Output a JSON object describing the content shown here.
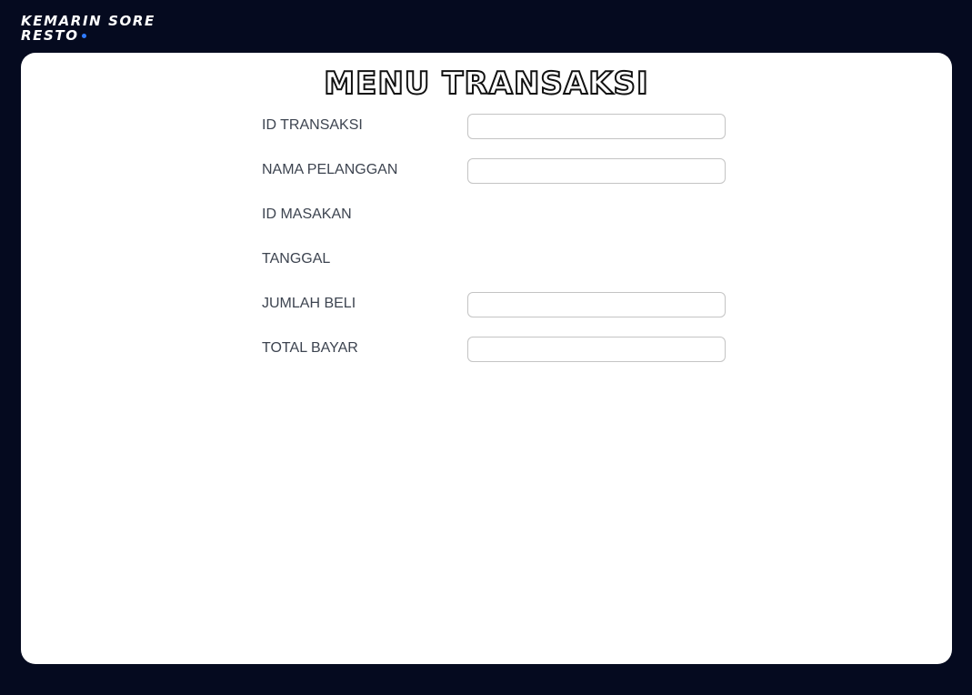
{
  "brand": {
    "line1": "KEMARIN SORE",
    "line2": "RESTO",
    "accent_color": "#2f7bff"
  },
  "page": {
    "title": "MENU TRANSAKSI"
  },
  "form": {
    "fields": [
      {
        "label": "ID TRANSAKSI",
        "value": "",
        "has_input": true
      },
      {
        "label": "NAMA PELANGGAN",
        "value": "",
        "has_input": true
      },
      {
        "label": "ID MASAKAN",
        "has_input": false
      },
      {
        "label": "TANGGAL",
        "has_input": false
      },
      {
        "label": "JUMLAH BELI",
        "value": "",
        "has_input": true
      },
      {
        "label": "TOTAL BAYAR",
        "value": "",
        "has_input": true
      }
    ]
  }
}
